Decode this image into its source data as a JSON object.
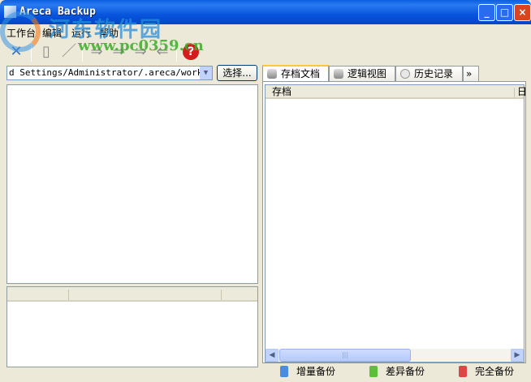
{
  "window": {
    "title": "Areca Backup",
    "min": "_",
    "max": "□",
    "close": "×"
  },
  "menu": [
    "工作台",
    "编辑",
    "运行",
    "帮助"
  ],
  "toolbar": {
    "help": "?"
  },
  "path_combo": {
    "value": "d Settings/Administrator/.areca/workspace"
  },
  "choose_button": "选择...",
  "tabs": [
    "存档文档",
    "逻辑视图",
    "历史记录"
  ],
  "tabs_more": "»",
  "columns": [
    "存档",
    "日"
  ],
  "legend": [
    {
      "label": "增量备份",
      "color": "#4a8de0"
    },
    {
      "label": "差异备份",
      "color": "#5cbf3a"
    },
    {
      "label": "完全备份",
      "color": "#e04545"
    }
  ],
  "watermark": {
    "name": "河东软件园",
    "url": "www.pc0359.cn"
  }
}
